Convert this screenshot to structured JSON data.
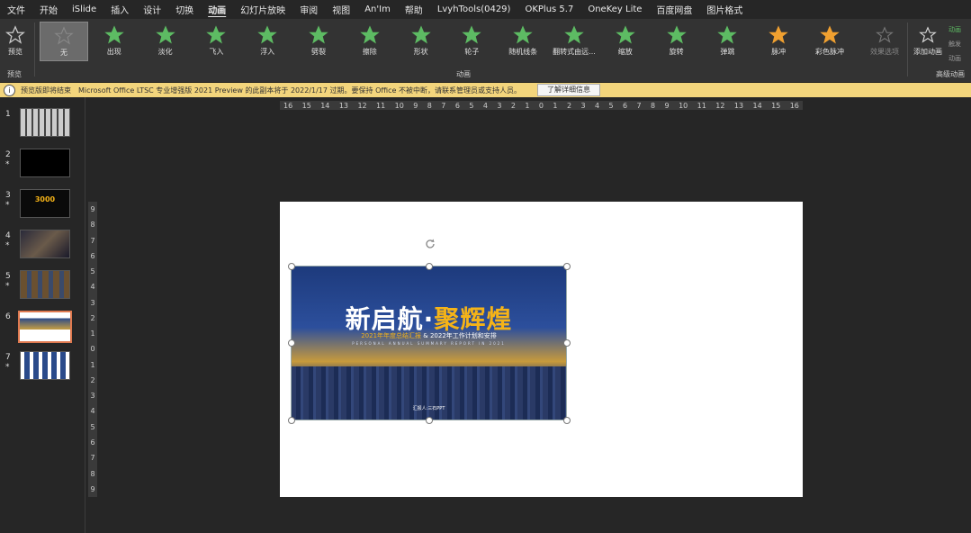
{
  "menu": [
    "文件",
    "开始",
    "iSlide",
    "插入",
    "设计",
    "切换",
    "动画",
    "幻灯片放映",
    "审阅",
    "视图",
    "An'Im",
    "帮助",
    "LvyhTools(0429)",
    "OKPlus 5.7",
    "OneKey Lite",
    "百度网盘",
    "图片格式"
  ],
  "menu_active_index": 6,
  "ribbon": {
    "preview_label": "预览",
    "preview_group": "预览",
    "anim_group": "动画",
    "advanced_group": "高级动画",
    "effects": [
      {
        "label": "无",
        "color": "#888888"
      },
      {
        "label": "出现",
        "color": "#5dbb63"
      },
      {
        "label": "淡化",
        "color": "#5dbb63"
      },
      {
        "label": "飞入",
        "color": "#5dbb63"
      },
      {
        "label": "浮入",
        "color": "#5dbb63"
      },
      {
        "label": "劈裂",
        "color": "#5dbb63"
      },
      {
        "label": "擦除",
        "color": "#5dbb63"
      },
      {
        "label": "形状",
        "color": "#5dbb63"
      },
      {
        "label": "轮子",
        "color": "#5dbb63"
      },
      {
        "label": "随机线条",
        "color": "#5dbb63"
      },
      {
        "label": "翻转式由远...",
        "color": "#5dbb63"
      },
      {
        "label": "缩放",
        "color": "#5dbb63"
      },
      {
        "label": "旋转",
        "color": "#5dbb63"
      },
      {
        "label": "弹跳",
        "color": "#5dbb63"
      },
      {
        "label": "脉冲",
        "color": "#f0a030"
      },
      {
        "label": "彩色脉冲",
        "color": "#f0a030"
      }
    ],
    "effect_options": "效果选项",
    "add_animation": "添加动画",
    "side_items": [
      "动画",
      "触发",
      "动画"
    ]
  },
  "notice": {
    "title": "预览版即将结束",
    "text": "Microsoft Office LTSC 专业增强版 2021 Preview 的此副本将于 2022/1/17 过期。要保持 Office 不被中断，请联系管理员或支持人员。",
    "button": "了解详细信息"
  },
  "slides": [
    {
      "num": "1",
      "star": ""
    },
    {
      "num": "2",
      "star": "*"
    },
    {
      "num": "3",
      "star": "*",
      "text": "3000"
    },
    {
      "num": "4",
      "star": "*"
    },
    {
      "num": "5",
      "star": "*"
    },
    {
      "num": "6",
      "star": ""
    },
    {
      "num": "7",
      "star": "*"
    }
  ],
  "ruler_h": [
    "16",
    "15",
    "14",
    "13",
    "12",
    "11",
    "10",
    "9",
    "8",
    "7",
    "6",
    "5",
    "4",
    "3",
    "2",
    "1",
    "0",
    "1",
    "2",
    "3",
    "4",
    "5",
    "6",
    "7",
    "8",
    "9",
    "10",
    "11",
    "12",
    "13",
    "14",
    "15",
    "16"
  ],
  "ruler_v": [
    "9",
    "8",
    "7",
    "6",
    "5",
    "4",
    "3",
    "2",
    "1",
    "0",
    "1",
    "2",
    "3",
    "4",
    "5",
    "6",
    "7",
    "8",
    "9"
  ],
  "picture": {
    "title_white": "新启航·",
    "title_yellow": "聚辉煌",
    "sub_left": "2021年年度总结汇报",
    "sub_amp": "&",
    "sub_right": "2022年工作计划和安排",
    "sub_en": "PERSONAL ANNUAL SUMMARY REPORT IN 2021",
    "reporter": "汇报人:三石PPT"
  }
}
